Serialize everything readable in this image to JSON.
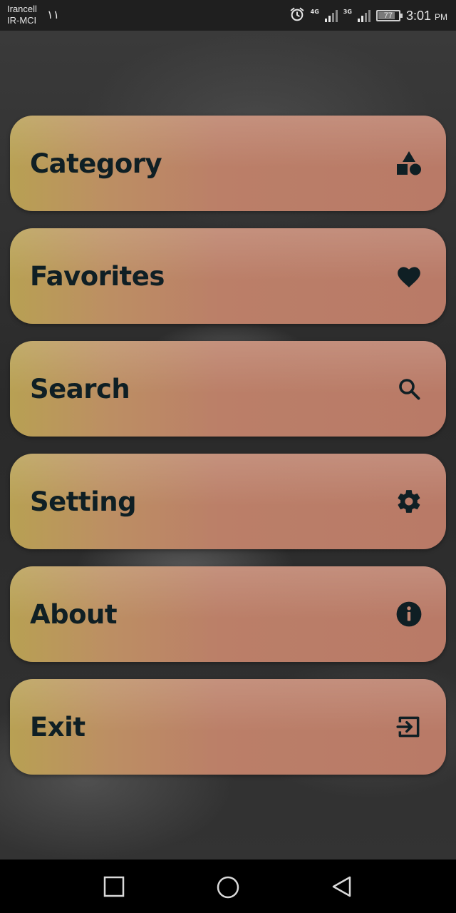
{
  "status_bar": {
    "carrier_line1": "Irancell",
    "carrier_line2": "IR-MCI",
    "sim_indicator": "١١",
    "net_4g": "4G",
    "net_3g": "3G",
    "battery_level": "77",
    "time": "3:01",
    "ampm": "PM",
    "icons": [
      "alarm-icon",
      "signal-icon",
      "battery-icon"
    ]
  },
  "menu": {
    "items": [
      {
        "label": "Category",
        "icon": "category-shapes-icon"
      },
      {
        "label": "Favorites",
        "icon": "heart-icon"
      },
      {
        "label": "Search",
        "icon": "search-icon"
      },
      {
        "label": "Setting",
        "icon": "gear-icon"
      },
      {
        "label": "About",
        "icon": "info-icon"
      },
      {
        "label": "Exit",
        "icon": "exit-icon"
      }
    ]
  },
  "nav_bar": {
    "buttons": [
      "recents-button",
      "home-button",
      "back-button"
    ]
  },
  "colors": {
    "button_gradient_start": "#b8a053",
    "button_gradient_end": "#b97a67",
    "label_text": "#0f1f24",
    "icon_color": "#0f1f24"
  }
}
